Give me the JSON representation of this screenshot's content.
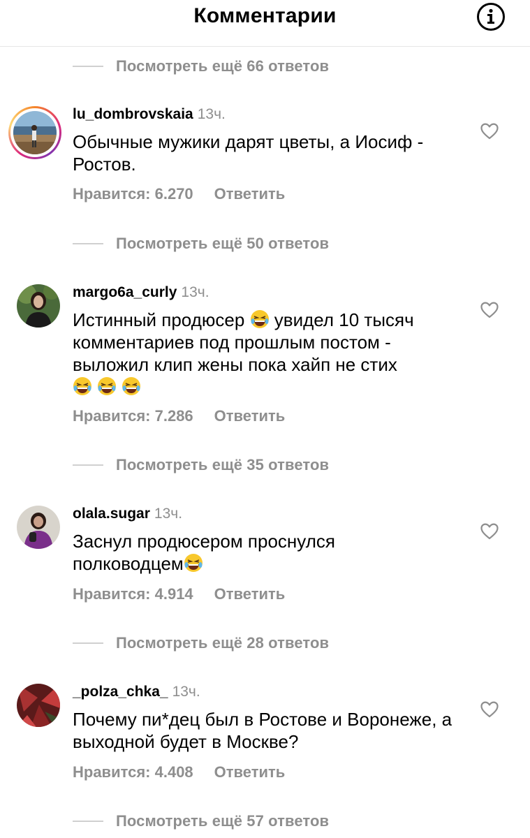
{
  "header": {
    "title": "Комментарии"
  },
  "comments": [
    {
      "view_more": "Посмотреть ещё 66 ответов",
      "username": "lu_dombrovskaia",
      "time": "13ч.",
      "text": "Обычные мужики дарят цветы, а Иосиф - Ростов.",
      "likes": "Нравится: 6.270",
      "reply": "Ответить"
    },
    {
      "view_more": "Посмотреть ещё 50 ответов",
      "username": "margo6a_curly",
      "time": "13ч.",
      "text_part1": "Истинный продюсер",
      "text_part2": "увидел 10 тысяч комментариев под прошлым постом - выложил клип жены пока хайп не стих",
      "likes": "Нравится: 7.286",
      "reply": "Ответить"
    },
    {
      "view_more": "Посмотреть ещё 35 ответов",
      "username": "olala.sugar",
      "time": "13ч.",
      "text": "Заснул продюсером проснулся полководцем",
      "likes": "Нравится: 4.914",
      "reply": "Ответить"
    },
    {
      "view_more": "Посмотреть ещё 28 ответов",
      "username": "_polza_chka_",
      "time": "13ч.",
      "text": "Почему пи*дец был в Ростове и Воронеже, а выходной будет в Москве?",
      "likes": "Нравится: 4.408",
      "reply": "Ответить"
    }
  ],
  "footer_view_more": "Посмотреть ещё 57 ответов",
  "icons": [
    "info-icon",
    "heart-icon",
    "laughing-emoji"
  ]
}
